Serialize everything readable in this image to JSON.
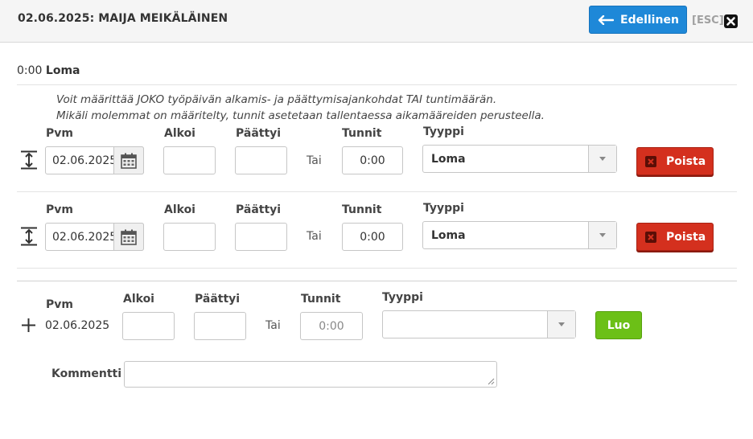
{
  "header": {
    "title": "02.06.2025: MAIJA MEIKÄLÄINEN",
    "back_label": "Edellinen",
    "esc_label": "[ESC]"
  },
  "summary": {
    "time": "0:00",
    "type": "Loma"
  },
  "info": {
    "line1": "Voit määrittää JOKO työpäivän alkamis- ja päättymisajankohdat TAI tuntimäärän.",
    "line2": "Mikäli molemmat on määritelty, tunnit asetetaan tallentaessa aikamääreiden perusteella."
  },
  "labels": {
    "date": "Pvm",
    "start": "Alkoi",
    "end": "Päättyi",
    "hours": "Tunnit",
    "type": "Tyyppi",
    "or": "Tai",
    "comment": "Kommentti"
  },
  "rows": [
    {
      "date": "02.06.2025",
      "start": "",
      "end": "",
      "hours": "0:00",
      "type": "Loma",
      "delete_label": "Poista"
    },
    {
      "date": "02.06.2025",
      "start": "",
      "end": "",
      "hours": "0:00",
      "type": "Loma",
      "delete_label": "Poista"
    }
  ],
  "new_row": {
    "date": "02.06.2025",
    "start": "",
    "end": "",
    "hours_placeholder": "0:00",
    "type": "",
    "create_label": "Luo"
  },
  "comment": {
    "value": ""
  },
  "colors": {
    "primary": "#1e88d8",
    "danger": "#d4301e",
    "success": "#6cc017"
  }
}
